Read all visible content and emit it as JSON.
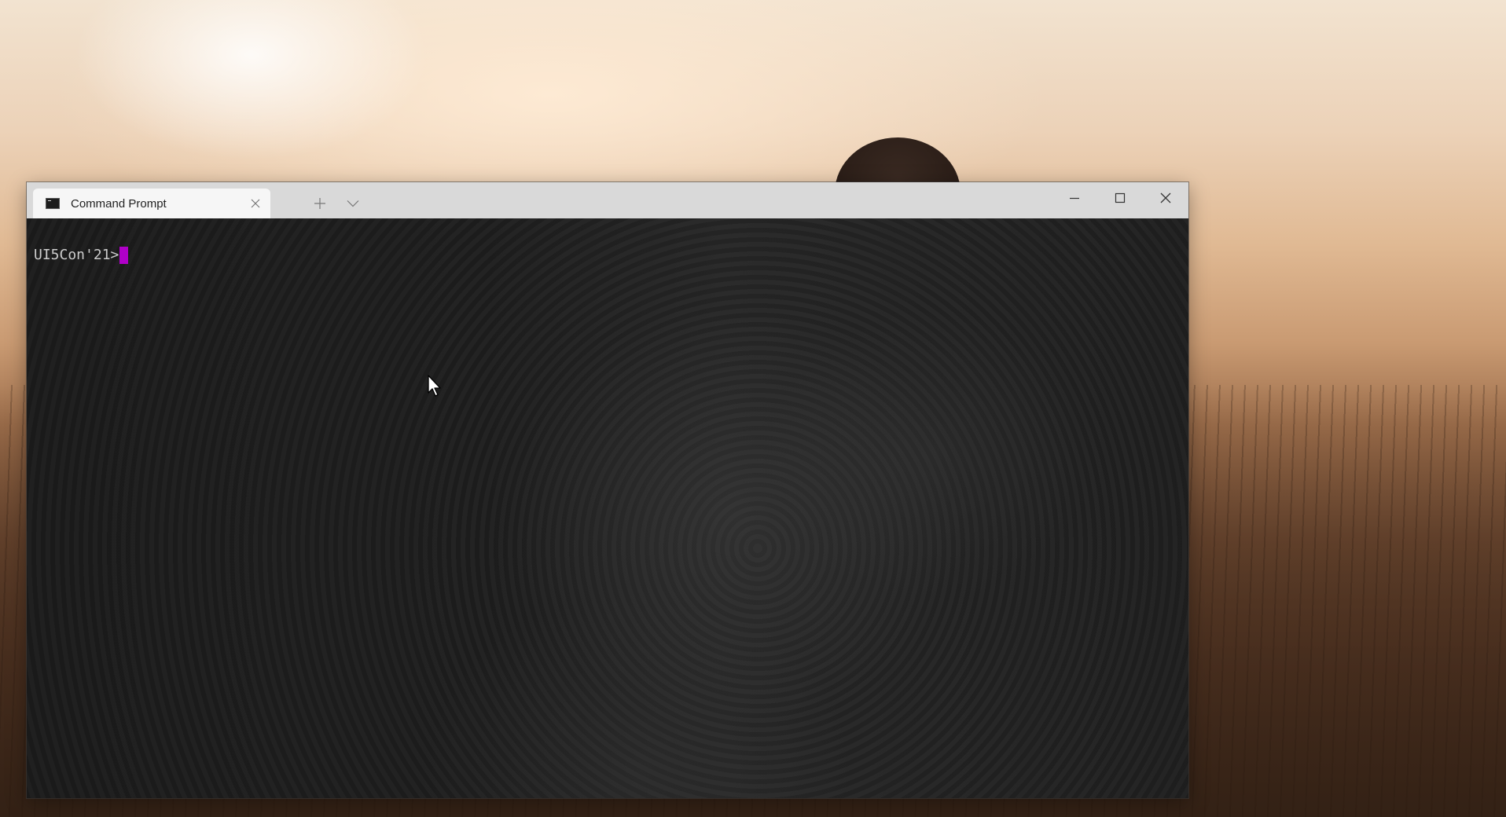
{
  "window": {
    "tab_title": "Command Prompt",
    "caption": {
      "minimize": "minimize",
      "maximize": "maximize",
      "close": "close"
    }
  },
  "terminal": {
    "prompt": "UI5Con'21>",
    "cursor_color": "#b000c8",
    "text_color": "#cccccc"
  },
  "icons": {
    "tab_icon": "terminal-icon",
    "tab_close": "close-icon",
    "new_tab": "plus-icon",
    "dropdown": "chevron-down-icon",
    "pointer": "mouse-pointer-icon"
  }
}
